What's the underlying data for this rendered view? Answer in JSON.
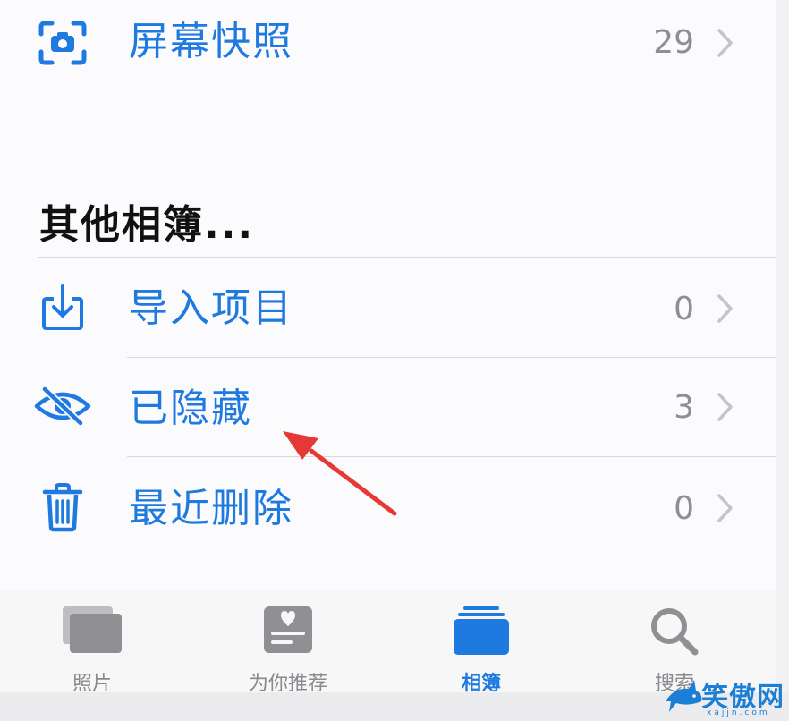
{
  "rows": [
    {
      "label": "屏幕快照",
      "count": "29",
      "icon": "screenshot-icon"
    },
    {
      "label": "导入项目",
      "count": "0",
      "icon": "import-icon"
    },
    {
      "label": "已隐藏",
      "count": "3",
      "icon": "eye-slash-icon"
    },
    {
      "label": "最近删除",
      "count": "0",
      "icon": "trash-icon"
    }
  ],
  "section_title": "其他相簿...",
  "tabs": [
    {
      "label": "照片",
      "icon": "photos-icon",
      "active": false
    },
    {
      "label": "为你推荐",
      "icon": "for-you-icon",
      "active": false
    },
    {
      "label": "相簿",
      "icon": "albums-icon",
      "active": true
    },
    {
      "label": "搜索",
      "icon": "search-icon",
      "active": false
    }
  ],
  "colors": {
    "accent": "#1f7ae0",
    "annotation_arrow": "#e53935",
    "muted": "#8e8e93"
  },
  "watermark": {
    "text": "笑傲网",
    "sub": "xajjn.com"
  }
}
